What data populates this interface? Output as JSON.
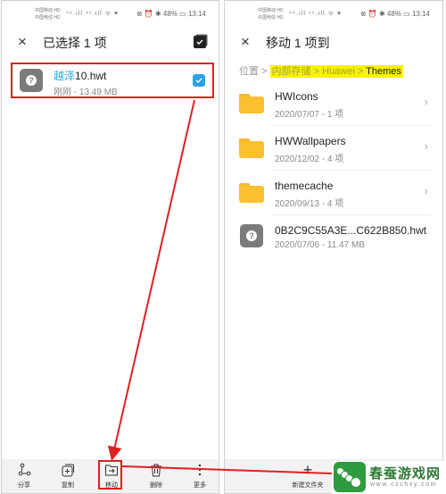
{
  "status_bar": {
    "carrier_1": "中国移动 HD",
    "carrier_2": "中国电信 HD",
    "signal": "⁴⁶.ıll ⁴⁶.ıll ᯤ ♥",
    "right_icons": "⊗ ⏰ ✱",
    "battery": "48%",
    "time": "13:14"
  },
  "left_screen": {
    "header": {
      "title": "已选择 1 项",
      "close_icon": "×"
    },
    "selected_file": {
      "name_highlight": "越泽",
      "name_rest": "10.hwt",
      "meta": "刚刚 - 13.49 MB",
      "checked": true
    },
    "toolbar": [
      {
        "label": "分享",
        "icon": "share-icon"
      },
      {
        "label": "复制",
        "icon": "copy-icon"
      },
      {
        "label": "移动",
        "icon": "move-icon"
      },
      {
        "label": "删除",
        "icon": "delete-icon"
      },
      {
        "label": "更多",
        "icon": "more-icon"
      }
    ]
  },
  "right_screen": {
    "header": {
      "title": "移动 1 项到",
      "close_icon": "×"
    },
    "breadcrumb": {
      "root": "位置",
      "sep": ">",
      "items": [
        "内部存储",
        "Huawei",
        "Themes"
      ]
    },
    "entries": [
      {
        "type": "folder",
        "name": "HWIcons",
        "meta": "2020/07/07 - 1 项"
      },
      {
        "type": "folder",
        "name": "HWWallpapers",
        "meta": "2020/12/02 - 4 项"
      },
      {
        "type": "folder",
        "name": "themecache",
        "meta": "2020/09/13 - 4 项"
      },
      {
        "type": "file",
        "name": "0B2C9C55A3E...C622B850.hwt",
        "meta": "2020/07/06 - 11.47 MB"
      }
    ],
    "toolbar": {
      "new_folder_label": "新建文件夹",
      "new_folder_icon": "+"
    }
  },
  "watermark": {
    "title": "春蚕游戏网",
    "url": "www.czchxy.com"
  },
  "colors": {
    "accent_blue": "#2aa3e6",
    "annotation_red": "#e02020",
    "highlight_yellow": "#f8f200",
    "folder_yellow": "#fbc02d",
    "watermark_green": "#2e9b3e"
  }
}
